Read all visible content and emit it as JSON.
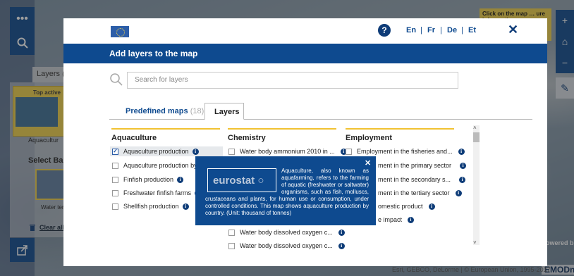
{
  "left": {
    "layers_tab": "Layers (",
    "top_active": "Top active",
    "aquacultur": "Aquacultur",
    "select_base": "Select Bas",
    "water_ter": "Water ter",
    "clear_all": "Clear all"
  },
  "right": {
    "tip": "Click on the map … ure info … ctive",
    "powered_by": "Powered b",
    "brand": "EMODne"
  },
  "attribution": "Esri, GEBCO, DeLorme | © European Union, 1995-2017",
  "modal": {
    "languages": [
      "En",
      "Fr",
      "De",
      "Et"
    ],
    "title": "Add layers to the map",
    "search_placeholder": "Search for layers",
    "tabs": {
      "predefined": "Predefined maps",
      "predefined_count": "(18)",
      "layers": "Layers"
    },
    "columns": {
      "aquaculture": {
        "heading": "Aquaculture",
        "items": [
          {
            "label": "Aquaculture production",
            "checked": true
          },
          {
            "label": "Aquaculture production by s",
            "checked": false
          },
          {
            "label": "Finfish production",
            "checked": false
          },
          {
            "label": "Freshwater finfish farms",
            "checked": false
          },
          {
            "label": "Shellfish production",
            "checked": false
          }
        ]
      },
      "chemistry": {
        "heading": "Chemistry",
        "items": [
          {
            "label": "Water body ammonium 2010 in ...",
            "checked": false
          },
          {
            "label": "Water body dissolved oxygen c...",
            "checked": false
          },
          {
            "label": "Water body dissolved oxygen c...",
            "checked": false
          }
        ]
      },
      "employment": {
        "heading": "Employment",
        "items": [
          {
            "label": "Employment in the fisheries and...",
            "checked": false
          },
          {
            "label": "ment in the primary sector"
          },
          {
            "label": "ment in the secondary s..."
          },
          {
            "label": "ment in the tertiary sector"
          },
          {
            "label": "omestic product"
          },
          {
            "label": "e impact"
          }
        ]
      }
    },
    "tooltip": {
      "logo": "eurostat",
      "text": "Aquaculture, also known as aquafarming, refers to the farming of aquatic (freshwater or saltwater) organisms, such as fish, molluscs, crustaceans and plants, for human use or consumption, under controlled conditions. This map shows aquaculture production by country. (Unit: thousand of tonnes)"
    }
  }
}
